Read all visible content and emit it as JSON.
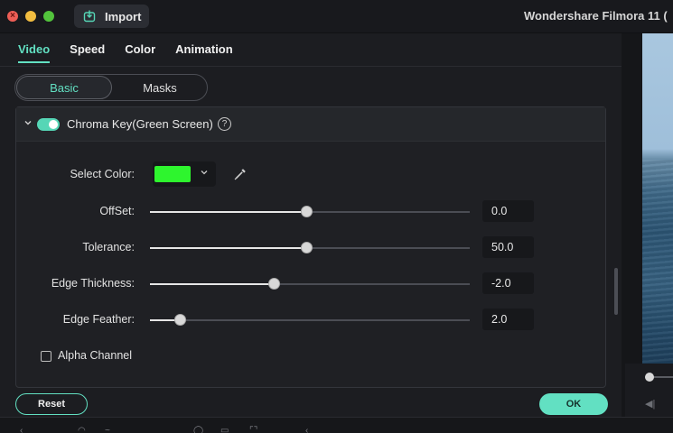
{
  "window": {
    "title": "Wondershare Filmora 11 (",
    "import_label": "Import"
  },
  "tabs": [
    {
      "label": "Video",
      "active": true
    },
    {
      "label": "Speed",
      "active": false
    },
    {
      "label": "Color",
      "active": false
    },
    {
      "label": "Animation",
      "active": false
    }
  ],
  "segments": [
    {
      "label": "Basic",
      "active": true
    },
    {
      "label": "Masks",
      "active": false
    }
  ],
  "chroma": {
    "title": "Chroma Key(Green Screen)",
    "enabled": true,
    "help_icon": "?",
    "select_color_label": "Select Color:",
    "selected_color": "#2ef52e",
    "sliders": [
      {
        "label": "OffSet:",
        "value_text": "0.0",
        "fraction": 0.489
      },
      {
        "label": "Tolerance:",
        "value_text": "50.0",
        "fraction": 0.489
      },
      {
        "label": "Edge Thickness:",
        "value_text": "-2.0",
        "fraction": 0.387
      },
      {
        "label": "Edge Feather:",
        "value_text": "2.0",
        "fraction": 0.093
      }
    ],
    "alpha_channel_label": "Alpha Channel",
    "alpha_channel_checked": false
  },
  "footer": {
    "reset_label": "Reset",
    "ok_label": "OK"
  },
  "colors": {
    "accent": "#62e0c2",
    "panel": "#1c1d21"
  },
  "icons": {
    "import": "import-icon",
    "eyedropper": "eyedropper-icon",
    "help": "help-icon",
    "collapse": "chevron-down-icon"
  }
}
